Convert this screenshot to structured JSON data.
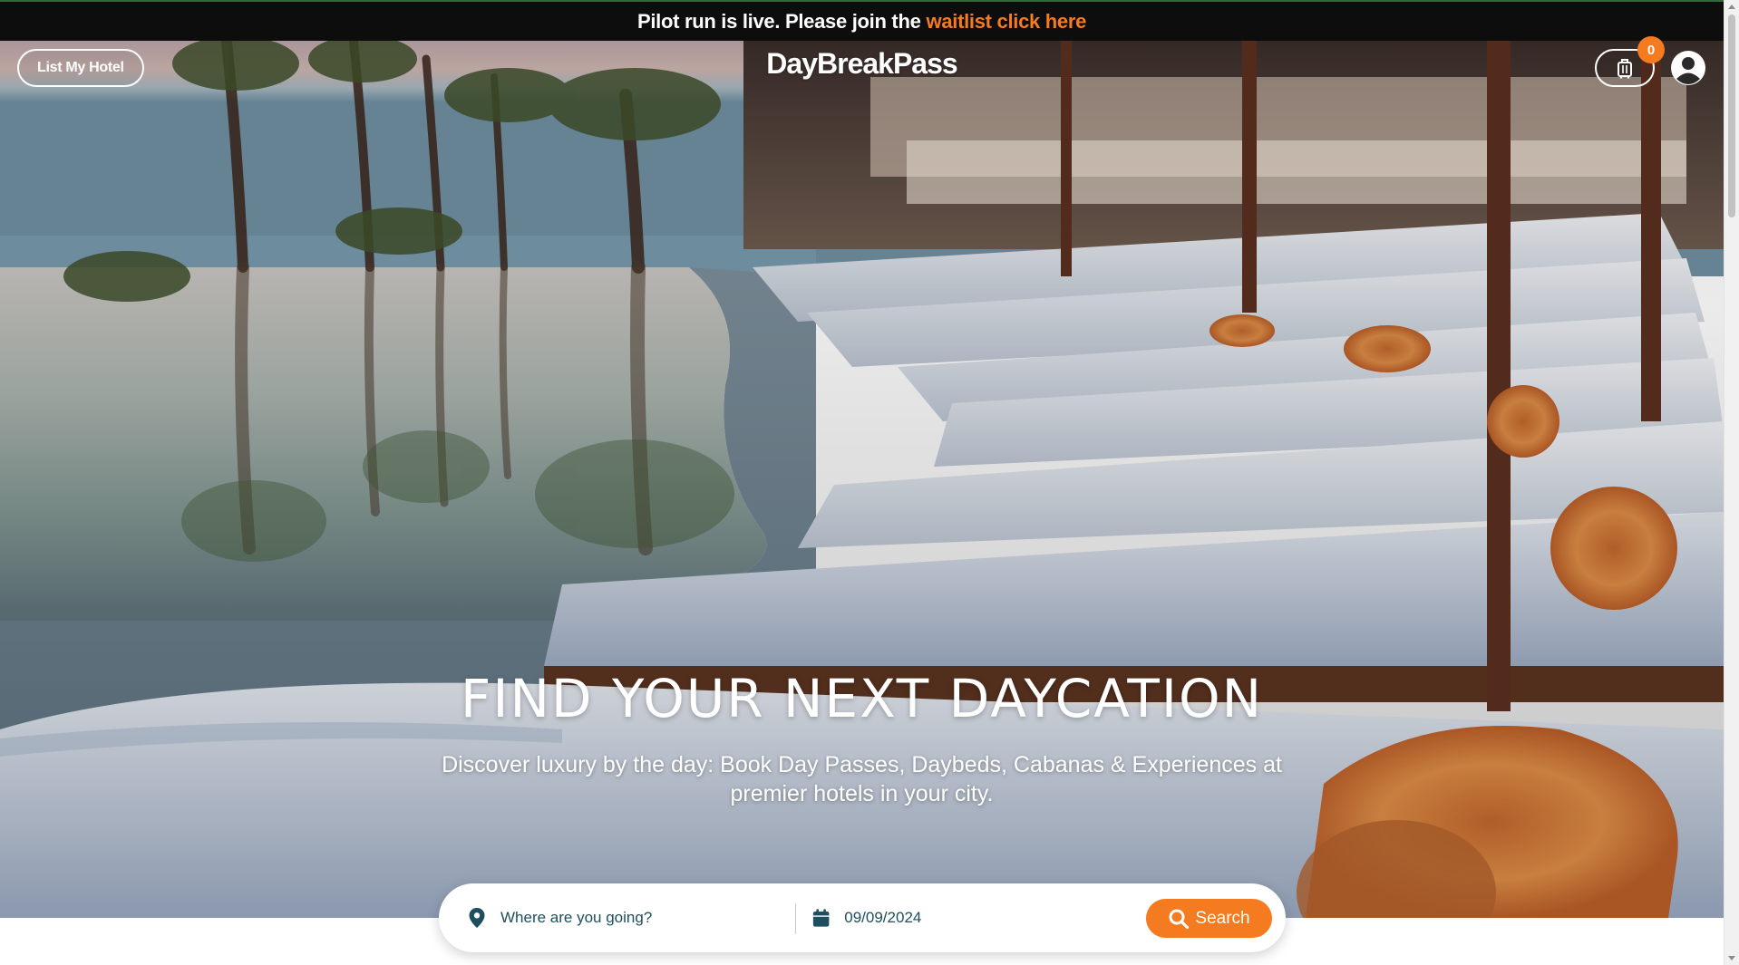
{
  "announcement": {
    "text": "Pilot run is live. Please join the",
    "link_text": "waitlist click here"
  },
  "header": {
    "list_hotel_label": "List My Hotel",
    "logo": "DayBreakPass",
    "cart_count": "0",
    "cart_icon": "luggage-icon",
    "account_icon": "user-circle-icon"
  },
  "hero": {
    "title": "FIND YOUR NEXT DAYCATION",
    "subtitle": "Discover luxury by the day: Book Day Passes, Daybeds, Cabanas & Experiences at premier hotels in your city."
  },
  "search": {
    "where_placeholder": "Where are you going?",
    "where_icon": "map-pin-icon",
    "date_value": "09/09/2024",
    "date_icon": "calendar-icon",
    "button_label": "Search",
    "button_icon": "search-icon"
  },
  "colors": {
    "accent": "#f47b20",
    "announcement_bg": "#0d0d0d",
    "field_text": "#1d4f5e"
  }
}
